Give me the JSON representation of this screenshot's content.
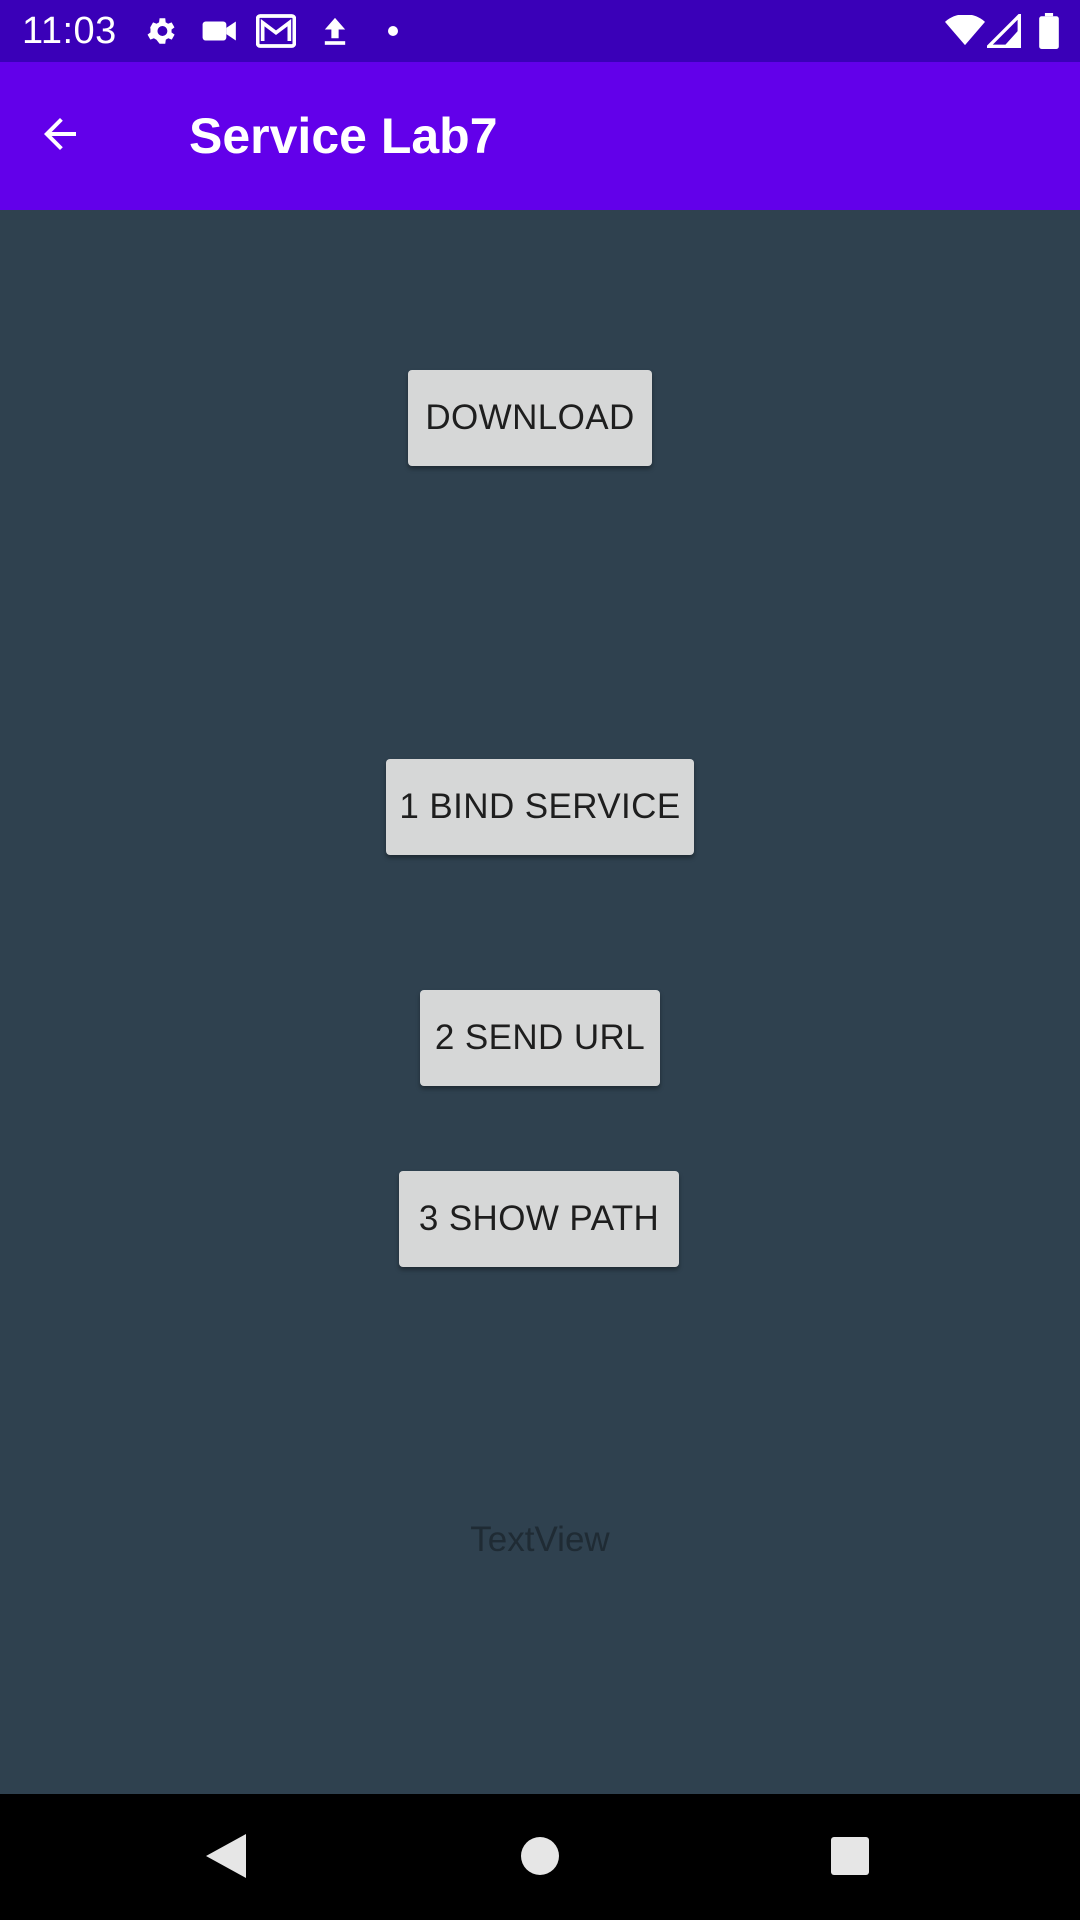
{
  "status_bar": {
    "time": "11:03",
    "icons": [
      "gear-icon",
      "video-camera-icon",
      "gmail-icon",
      "upload-icon",
      "dot-icon",
      "wifi-icon",
      "signal-icon",
      "battery-icon"
    ]
  },
  "app_bar": {
    "title": "Service Lab7",
    "back_icon": "arrow-back-icon"
  },
  "buttons": {
    "download": "DOWNLOAD",
    "bind_service": "1 BIND SERVICE",
    "send_url": "2 SEND URL",
    "show_path": "3 SHOW PATH"
  },
  "text_view": "TextView",
  "nav_bar": {
    "back": "nav-back-icon",
    "home": "nav-home-icon",
    "recents": "nav-recents-icon"
  },
  "colors": {
    "status_bar": "#3a00b8",
    "app_bar": "#6200ea",
    "background": "#2f414f",
    "button": "#d6d7d7",
    "button_text": "#1e1e1e",
    "nav_bar": "#000000"
  }
}
